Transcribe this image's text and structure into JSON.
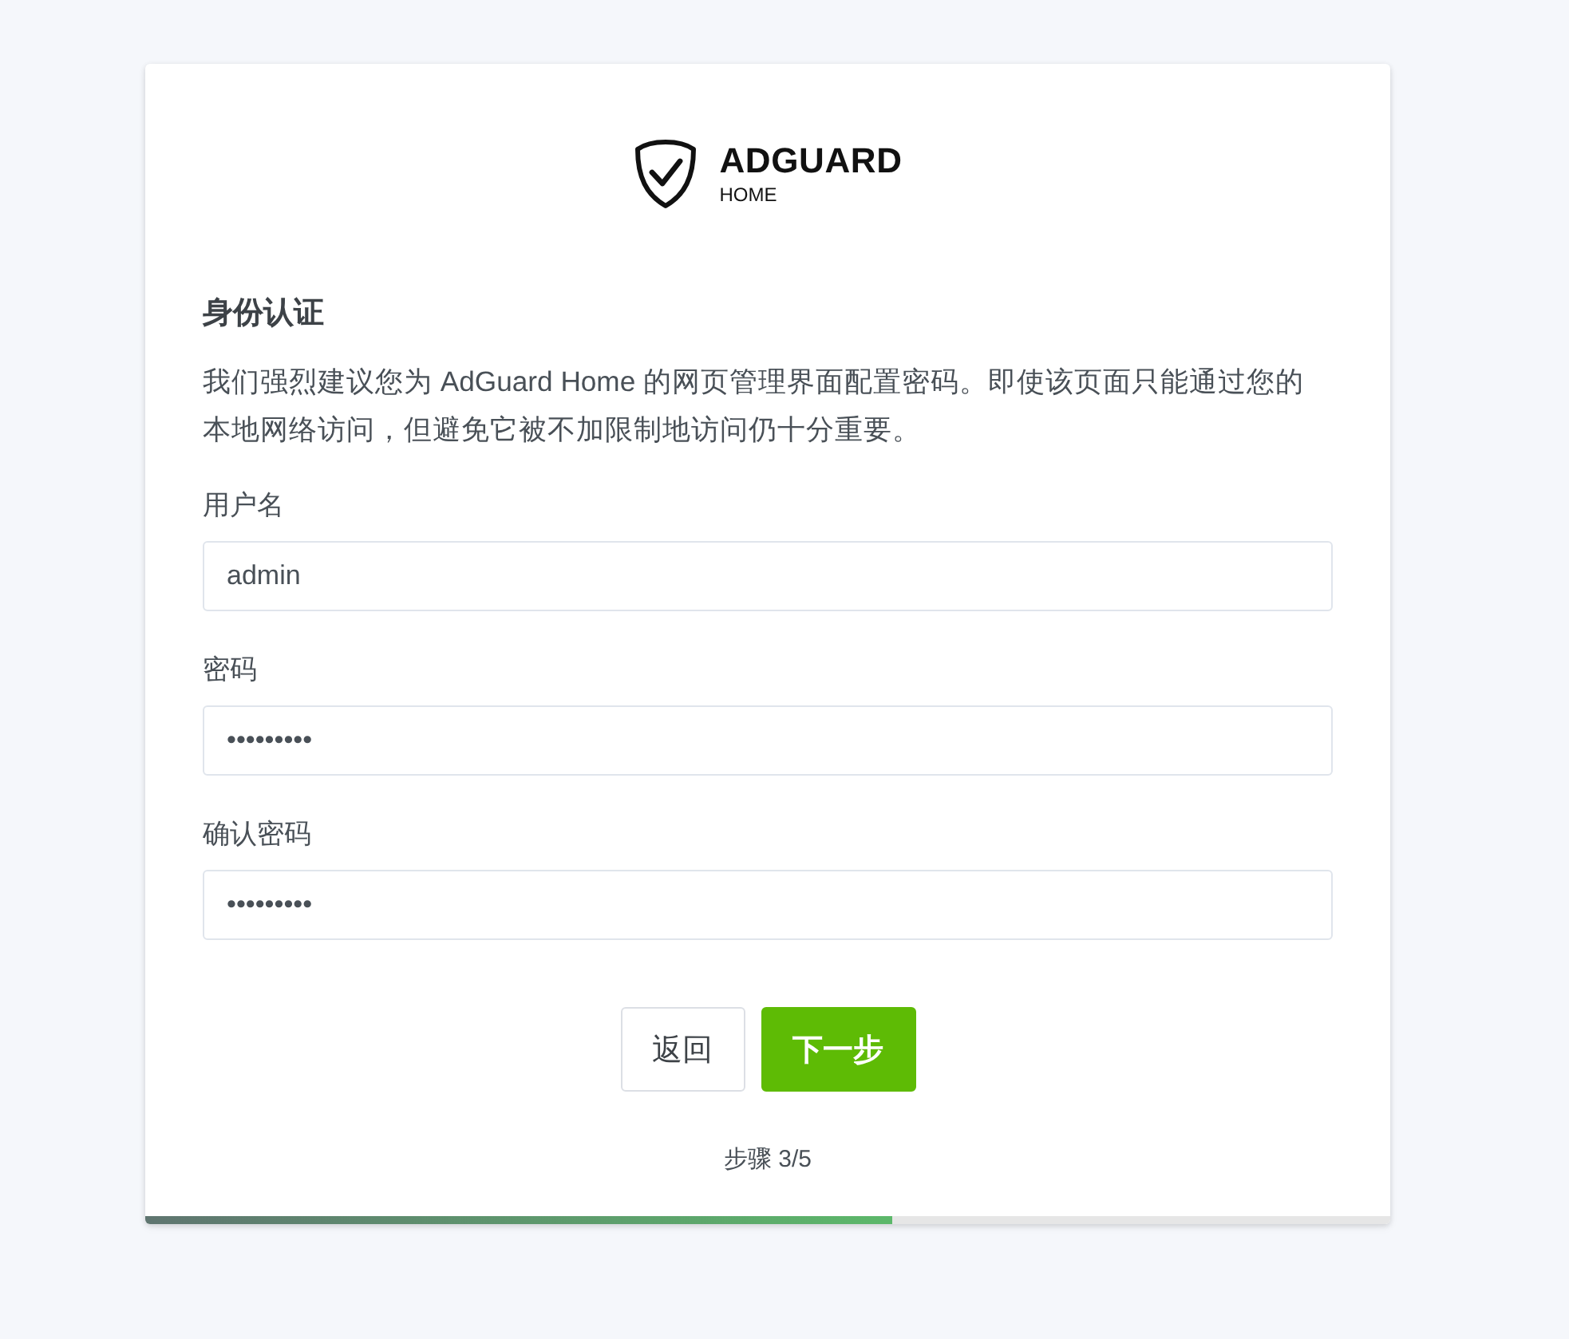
{
  "logo": {
    "wordmark": "ADGUARD",
    "subtitle": "HOME"
  },
  "heading": "身份认证",
  "description": "我们强烈建议您为 AdGuard Home 的网页管理界面配置密码。即使该页面只能通过您的本地网络访问，但避免它被不加限制地访问仍十分重要。",
  "fields": [
    {
      "label": "用户名",
      "value": "admin"
    },
    {
      "label": "密码",
      "value": "•••••••••"
    },
    {
      "label": "确认密码",
      "value": "•••••••••"
    }
  ],
  "buttons": [
    {
      "label": "返回",
      "kind": "secondary"
    },
    {
      "label": "下一步",
      "kind": "primary"
    }
  ],
  "step": "步骤 3/5",
  "progress": {
    "level": 0.6
  }
}
